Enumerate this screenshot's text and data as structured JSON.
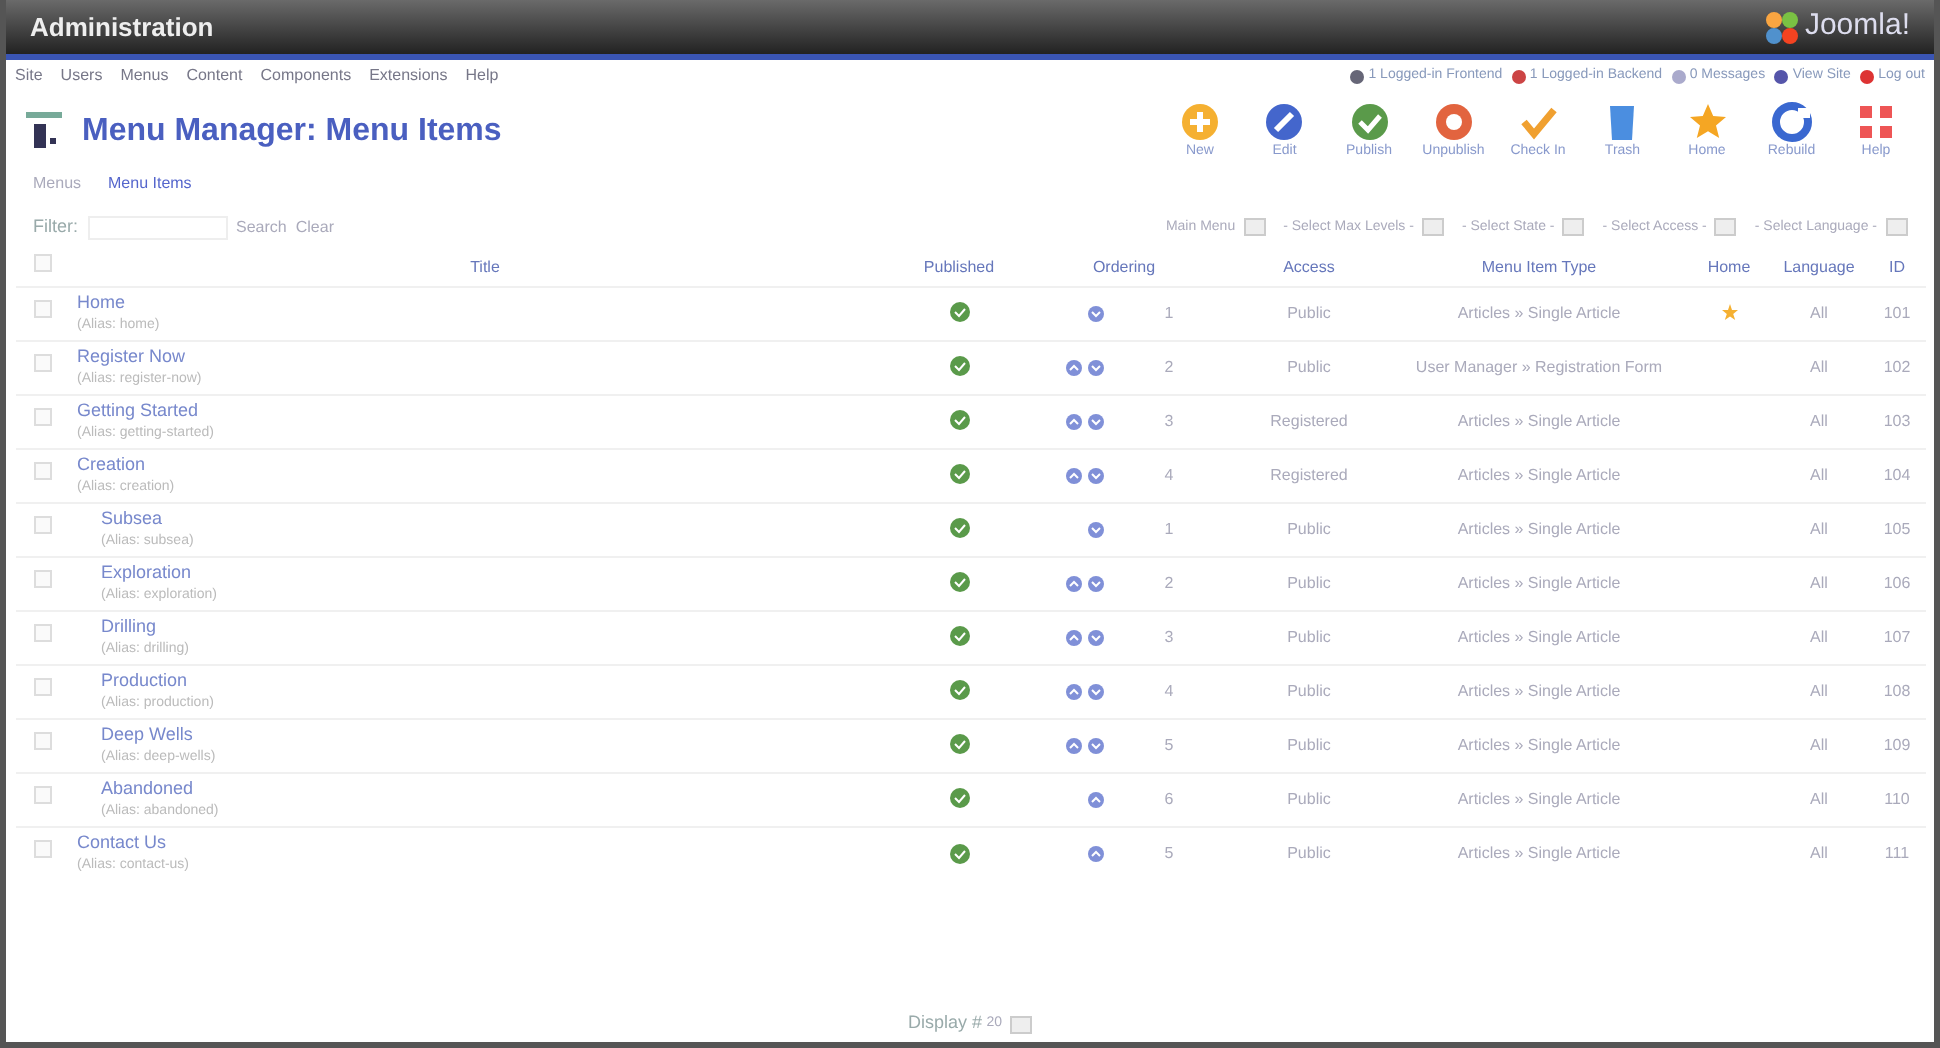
{
  "header": {
    "title": "Administration",
    "logo_text": "Joomla!"
  },
  "menu": [
    "Site",
    "Users",
    "Menus",
    "Content",
    "Components",
    "Extensions",
    "Help"
  ],
  "status_links": [
    "1 Logged-in Frontend",
    "1 Logged-in Backend",
    "0 Messages",
    "View Site",
    "Log out"
  ],
  "page_title": "Menu Manager: Menu Items",
  "toolbar": [
    "New",
    "Edit",
    "Publish",
    "Unpublish",
    "Check In",
    "Trash",
    "Home",
    "Rebuild",
    "Help"
  ],
  "submenu": [
    {
      "label": "Menus",
      "selected": false
    },
    {
      "label": "Menu Items",
      "selected": true
    }
  ],
  "filter": {
    "label": "Filter:",
    "buttons": [
      "Search",
      "Clear"
    ]
  },
  "selects": [
    "Main Menu",
    "- Select Max Levels -",
    "- Select State -",
    "- Select Access -",
    "- Select Language -"
  ],
  "table": {
    "select_all_checked": false,
    "columns": [
      "Title",
      "Published",
      "Ordering",
      "Access",
      "Menu Item Type",
      "Home",
      "Language",
      "ID"
    ],
    "rows": [
      {
        "title": "Home",
        "alias": "(Alias: home)",
        "checked": false,
        "published": true,
        "up": false,
        "down": true,
        "ordering": "1",
        "access": "Public",
        "type": "Articles » Single Article",
        "home": true,
        "language": "All",
        "id": "101"
      },
      {
        "title": "Register Now",
        "alias": "(Alias: register-now)",
        "checked": false,
        "published": true,
        "up": true,
        "down": true,
        "ordering": "2",
        "access": "Public",
        "type": "User Manager » Registration Form",
        "home": false,
        "language": "All",
        "id": "102"
      },
      {
        "title": "Getting Started",
        "alias": "(Alias: getting-started)",
        "checked": false,
        "published": true,
        "up": true,
        "down": true,
        "ordering": "3",
        "access": "Registered",
        "type": "Articles » Single Article",
        "home": false,
        "language": "All",
        "id": "103"
      },
      {
        "title": "Creation",
        "alias": "(Alias: creation)",
        "checked": false,
        "published": true,
        "up": true,
        "down": true,
        "ordering": "4",
        "access": "Registered",
        "type": "Articles » Single Article",
        "home": false,
        "language": "All",
        "id": "104",
        "children": [
          {
            "title": "Subsea",
            "alias": "(Alias: subsea)",
            "checked": false,
            "published": true,
            "up": false,
            "down": true,
            "ordering": "1",
            "access": "Public",
            "type": "Articles » Single Article",
            "home": false,
            "language": "All",
            "id": "105"
          },
          {
            "title": "Exploration",
            "alias": "(Alias: exploration)",
            "checked": false,
            "published": true,
            "up": true,
            "down": true,
            "ordering": "2",
            "access": "Public",
            "type": "Articles » Single Article",
            "home": false,
            "language": "All",
            "id": "106"
          },
          {
            "title": "Drilling",
            "alias": "(Alias: drilling)",
            "checked": false,
            "published": true,
            "up": true,
            "down": true,
            "ordering": "3",
            "access": "Public",
            "type": "Articles » Single Article",
            "home": false,
            "language": "All",
            "id": "107"
          },
          {
            "title": "Production",
            "alias": "(Alias: production)",
            "checked": false,
            "published": true,
            "up": true,
            "down": true,
            "ordering": "4",
            "access": "Public",
            "type": "Articles » Single Article",
            "home": false,
            "language": "All",
            "id": "108"
          },
          {
            "title": "Deep Wells",
            "alias": "(Alias: deep-wells)",
            "checked": false,
            "published": true,
            "up": true,
            "down": true,
            "ordering": "5",
            "access": "Public",
            "type": "Articles » Single Article",
            "home": false,
            "language": "All",
            "id": "109"
          },
          {
            "title": "Abandoned",
            "alias": "(Alias: abandoned)",
            "checked": false,
            "published": true,
            "up": true,
            "down": false,
            "ordering": "6",
            "access": "Public",
            "type": "Articles » Single Article",
            "home": false,
            "language": "All",
            "id": "110"
          }
        ]
      },
      {
        "title": "Contact Us",
        "alias": "(Alias: contact-us)",
        "checked": false,
        "published": true,
        "up": true,
        "down": false,
        "ordering": "5",
        "access": "Public",
        "type": "Articles » Single Article",
        "home": false,
        "language": "All",
        "id": "111"
      }
    ]
  },
  "footer": {
    "label": "Display #",
    "value": "20"
  }
}
